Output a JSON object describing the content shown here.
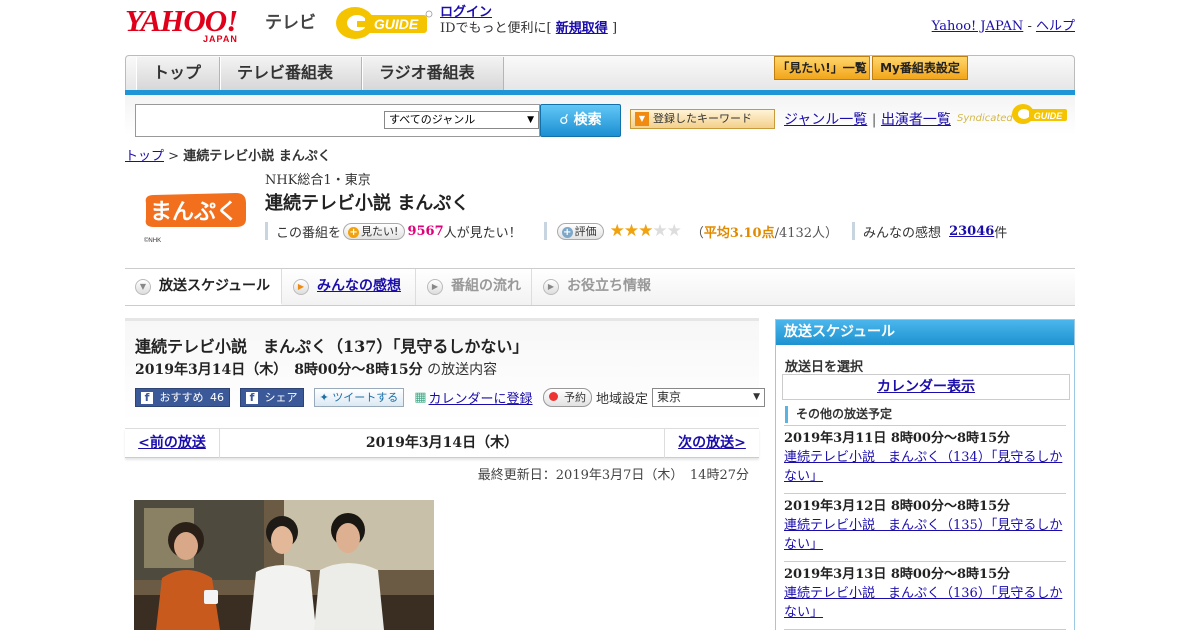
{
  "header": {
    "yahoo_logo": "YAHOO!",
    "yahoo_logo_sub": "JAPAN",
    "tv_label": "テレビ",
    "gguide_logo": "GUIDE",
    "login_link": "ログイン",
    "login_note_prefix": "IDでもっと便利に[",
    "register_link": "新規取得",
    "login_note_suffix": "]",
    "yahoo_japan_link": "Yahoo! JAPAN",
    "separator": "-",
    "help_link": "ヘルプ"
  },
  "nav": {
    "tabs": [
      {
        "label": "トップ"
      },
      {
        "label": "テレビ番組表"
      },
      {
        "label": "ラジオ番組表"
      }
    ],
    "want_list_button": "「見たい!」一覧",
    "my_schedule_button": "My番組表設定"
  },
  "search": {
    "query": "",
    "genre_selected": "すべてのジャンル",
    "search_button": "検索",
    "keyword_button": "登録したキーワード",
    "genre_list_link": "ジャンル一覧",
    "link_separator": "|",
    "cast_list_link": "出演者一覧",
    "syndicated_label": "Syndicated",
    "syndicated_logo": "GUIDE"
  },
  "breadcrumb": {
    "home": "トップ",
    "sep": ">",
    "current": "連続テレビ小説 まんぷく"
  },
  "program": {
    "logo_text": "まんぷく",
    "logo_credit": "©NHK",
    "channel": "NHK総合1・東京",
    "title": "連続テレビ小説 まんぷく",
    "want_prefix": "この番組を",
    "want_button": "見たい!",
    "want_count": "9567",
    "want_suffix": "人が見たい！",
    "rate_button": "評価",
    "rating": 3.1,
    "rating_open": "（",
    "rating_label": "平均3.10点",
    "rating_people": "/4132人）",
    "comments_label": "みんなの感想",
    "comments_count": "23046",
    "comments_unit": "件"
  },
  "subtabs": [
    {
      "label": "放送スケジュール",
      "state": "active"
    },
    {
      "label": "みんなの感想",
      "state": "link"
    },
    {
      "label": "番組の流れ",
      "state": "disabled"
    },
    {
      "label": "お役立ち情報",
      "state": "disabled"
    }
  ],
  "episode": {
    "title": "連続テレビ小説　まんぷく（137）「見守るしかない」",
    "datetime": "2019年3月14日（木）　8時00分～8時15分",
    "datetime_suffix": "の放送内容",
    "recommend_label": "おすすめ",
    "recommend_count": "46",
    "share_label": "シェア",
    "tweet_label": "ツイートする",
    "calendar_link": "カレンダーに登録",
    "reserve_button": "予約",
    "region_label": "地域設定",
    "region_value": "東京",
    "prev_link": "<前の放送",
    "current_date": "2019年3月14日（木）",
    "next_link": "次の放送>",
    "updated": "最終更新日：2019年3月7日（木）　14時27分"
  },
  "sidebar": {
    "header": "放送スケジュール",
    "select_date_label": "放送日を選択",
    "calendar_link": "カレンダー表示",
    "other_label": "その他の放送予定",
    "items": [
      {
        "time": "2019年3月11日  8時00分～8時15分",
        "title": "連続テレビ小説　まんぷく（134）「見守るしかない」"
      },
      {
        "time": "2019年3月12日  8時00分～8時15分",
        "title": "連続テレビ小説　まんぷく（135）「見守るしかない」"
      },
      {
        "time": "2019年3月13日  8時00分～8時15分",
        "title": "連続テレビ小説　まんぷく（136）「見守るしかない」"
      }
    ]
  },
  "colors": {
    "accent_blue": "#1e95d6",
    "brand_red": "#e0001a",
    "link": "#1a0dab",
    "gguide_yellow": "#f5c400",
    "star": "#f1a20e"
  }
}
